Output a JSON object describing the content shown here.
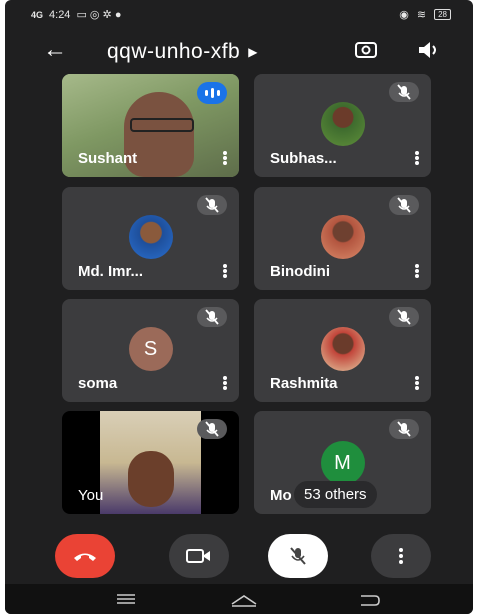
{
  "status": {
    "time": "4:24",
    "signal": "4G",
    "battery": "28"
  },
  "header": {
    "meeting_code": "qqw-unho-xfb"
  },
  "participants": [
    {
      "name": "Sushant",
      "muted": false,
      "speaking": true
    },
    {
      "name": "Subhas...",
      "muted": true
    },
    {
      "name": "Md. Imr...",
      "muted": true
    },
    {
      "name": "Binodini",
      "muted": true
    },
    {
      "name": "soma",
      "muted": true,
      "initial": "S",
      "avatar_color": "#9b6a59"
    },
    {
      "name": "Rashmita",
      "muted": true
    },
    {
      "name": "You",
      "muted": true
    },
    {
      "name": "Mo",
      "muted": true,
      "initial": "M",
      "avatar_color": "#1f8e3d",
      "others_label": "53 others"
    }
  ],
  "colors": {
    "end_call": "#ea4335",
    "speaking_badge": "#1a73e8"
  }
}
